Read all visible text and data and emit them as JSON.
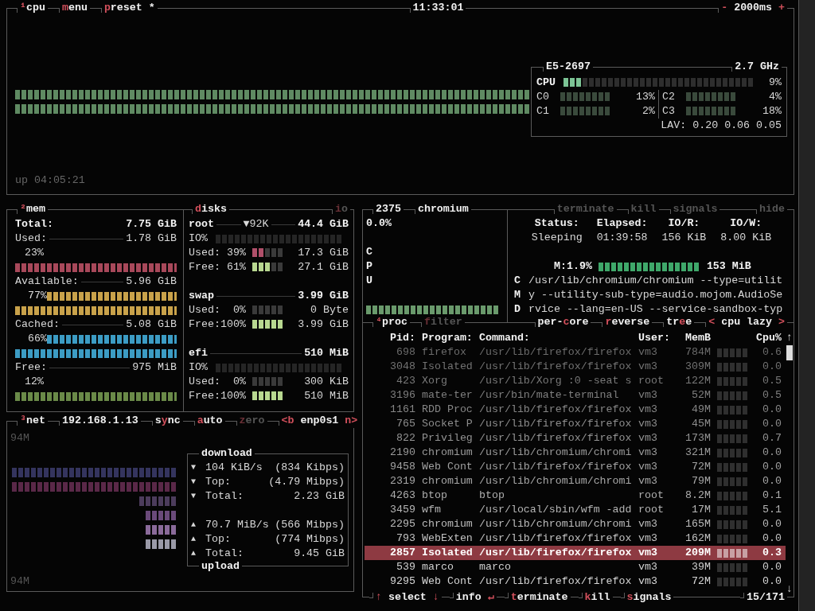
{
  "cpu": {
    "tabs": [
      {
        "hotkey": "¹",
        "label": "cpu",
        "disabled": false
      },
      {
        "hotkey": "m",
        "label": "enu",
        "disabled": false
      },
      {
        "hotkey": "p",
        "label": "reset *",
        "disabled": false
      }
    ],
    "clock": "11:33:01",
    "interval": {
      "hotkey": "-",
      "label": " 2000ms ",
      "hotkey_end": "+",
      "disabled": false
    },
    "info": {
      "model": "E5-2697",
      "frequency": "2.7 GHz",
      "total": {
        "label": "CPU",
        "level": 0.09,
        "value": "9%"
      },
      "cores": [
        {
          "label": "C0",
          "value": "13%"
        },
        {
          "label": "C2",
          "value": "4%"
        },
        {
          "label": "C1",
          "value": "2%"
        },
        {
          "label": "C3",
          "value": "18%"
        }
      ],
      "load_label": "LAV:",
      "load": [
        "0.20",
        "0.06",
        "0.05"
      ]
    },
    "uptime": "up 04:05:21"
  },
  "mem": {
    "tabs": [
      {
        "hotkey": "²",
        "label": "mem",
        "disabled": false
      }
    ],
    "total": {
      "label": "Total:",
      "value": "7.75 GiB"
    },
    "items": [
      {
        "kind": "separate",
        "label": "Used:",
        "value": "1.78 GiB",
        "percent": "23%",
        "color": "#a8485a"
      },
      {
        "kind": "inline",
        "label": "Available:",
        "value": "5.96 GiB",
        "percent": "77%",
        "color": "#c9a24a"
      },
      {
        "kind": "inline",
        "label": "Cached:",
        "value": "5.08 GiB",
        "percent": "66%",
        "color": "#3c9cc4"
      },
      {
        "kind": "separate",
        "label": "Free:",
        "value": "975 MiB",
        "percent": "12%",
        "color": "#6a8a48"
      }
    ]
  },
  "disks": {
    "tabs": [
      {
        "hotkey": "d",
        "label": "isks",
        "disabled": false
      }
    ],
    "tabs_right": [
      {
        "hotkey": "i",
        "label": "o",
        "disabled": true
      }
    ],
    "items": [
      {
        "name": "root",
        "rate": "▼92K",
        "size": "44.4 GiB",
        "rows": [
          {
            "kind": "io",
            "label": "IO%"
          },
          {
            "kind": "used",
            "label": "Used:",
            "percent": "39%",
            "level": 0.39,
            "value": "17.3 GiB"
          },
          {
            "kind": "free",
            "label": "Free:",
            "percent": "61%",
            "level": 0.61,
            "value": "27.1 GiB"
          }
        ]
      },
      {
        "name": "swap",
        "size": "3.99 GiB",
        "rows": [
          {
            "kind": "used",
            "label": "Used:",
            "percent": "0%",
            "level": 0,
            "value": "0 Byte"
          },
          {
            "kind": "free",
            "label": "Free:",
            "percent": "100%",
            "level": 1,
            "value": "3.99 GiB"
          }
        ]
      },
      {
        "name": "efi",
        "size": "510 MiB",
        "rows": [
          {
            "kind": "io",
            "label": "IO%"
          },
          {
            "kind": "used",
            "label": "Used:",
            "percent": "0%",
            "level": 0,
            "value": "300 KiB"
          },
          {
            "kind": "free",
            "label": "Free:",
            "percent": "100%",
            "level": 1,
            "value": "510 MiB"
          }
        ]
      }
    ]
  },
  "net": {
    "tabs": [
      {
        "hotkey": "³",
        "label": "net",
        "disabled": false
      },
      {
        "label": "192.168.1.13",
        "disabled": false
      },
      {
        "prefix": "s",
        "hotkey": "y",
        "label": "nc",
        "disabled": false
      },
      {
        "hotkey": "a",
        "label": "uto",
        "disabled": false
      },
      {
        "hotkey": "z",
        "label": "ero",
        "disabled": true
      },
      {
        "hotkey": "<b",
        "label": " enp0s1 ",
        "hotkey_end": "n>",
        "disabled": false
      }
    ],
    "scale_top": "94M",
    "scale_bottom": "94M",
    "download": {
      "title": "download",
      "rows": [
        {
          "arrow": "▼",
          "label": "104 KiB/s",
          "value": "(834 Kibps)"
        },
        {
          "arrow": "▼",
          "label": "Top:",
          "value": "(4.79 Mibps)"
        },
        {
          "arrow": "▼",
          "label": "Total:",
          "value": "2.23 GiB"
        }
      ]
    },
    "upload": {
      "title": "upload",
      "rows": [
        {
          "arrow": "▲",
          "label": "70.7 MiB/s",
          "value": "(566 Mibps)"
        },
        {
          "arrow": "▲",
          "label": "Top:",
          "value": "(774 Mibps)"
        },
        {
          "arrow": "▲",
          "label": "Total:",
          "value": "9.45 GiB"
        }
      ]
    }
  },
  "detail": {
    "pid": "2375",
    "name": "chromium",
    "tabs": [
      {
        "label": "terminate",
        "disabled": true
      },
      {
        "label": "kill",
        "disabled": true
      },
      {
        "label": "signals",
        "disabled": true
      }
    ],
    "tabs_right": [
      {
        "label": "hide",
        "disabled": true
      }
    ],
    "cpu": "0.0%",
    "cpu_label": "CPU",
    "stats": [
      {
        "label": "Status:",
        "value": "Sleeping"
      },
      {
        "label": "Elapsed:",
        "value": "01:39:58"
      },
      {
        "label": "IO/R:",
        "value": "156 KiB"
      },
      {
        "label": "IO/W:",
        "value": "8.00 KiB"
      }
    ],
    "memory": {
      "label": "M:1.9%",
      "value": "153 MiB"
    },
    "cmd_label": "CMD",
    "command_lines": [
      "/usr/lib/chromium/chromium --type=utilit",
      "y --utility-sub-type=audio.mojom.AudioSe",
      "rvice --lang=en-US --service-sandbox-typ"
    ]
  },
  "proc": {
    "tabs": [
      {
        "hotkey": "⁴",
        "label": "proc",
        "disabled": false
      },
      {
        "hotkey": "f",
        "label": "ilter",
        "disabled": true
      }
    ],
    "tabs_right": [
      {
        "prefix": "per-",
        "hotkey": "c",
        "label": "ore",
        "disabled": false
      },
      {
        "hotkey": "r",
        "label": "everse",
        "disabled": false
      },
      {
        "prefix": "tr",
        "hotkey": "e",
        "label": "e",
        "disabled": false
      },
      {
        "hotkey": "<",
        "label": " cpu lazy ",
        "hotkey_end": ">",
        "disabled": false
      }
    ],
    "columns": [
      "Pid:",
      "Program:",
      "Command:",
      "User:",
      "MemB",
      "Cpu%"
    ],
    "scroll_up": "↑",
    "scroll_down": "↓",
    "rows": [
      {
        "pid": "698",
        "program": "firefox",
        "command": "/usr/lib/firefox/firefox",
        "user": "vm3",
        "memory": "784M",
        "cpu": "0.6",
        "selected": false
      },
      {
        "pid": "3048",
        "program": "Isolated",
        "command": "/usr/lib/firefox/firefox",
        "user": "vm3",
        "memory": "309M",
        "cpu": "0.0",
        "selected": false
      },
      {
        "pid": "423",
        "program": "Xorg",
        "command": "/usr/lib/Xorg :0 -seat s",
        "user": "root",
        "memory": "122M",
        "cpu": "0.5",
        "selected": false
      },
      {
        "pid": "3196",
        "program": "mate-ter",
        "command": "/usr/bin/mate-terminal",
        "user": "vm3",
        "memory": "52M",
        "cpu": "0.5",
        "selected": false
      },
      {
        "pid": "1161",
        "program": "RDD Proc",
        "command": "/usr/lib/firefox/firefox",
        "user": "vm3",
        "memory": "49M",
        "cpu": "0.0",
        "selected": false
      },
      {
        "pid": "765",
        "program": "Socket P",
        "command": "/usr/lib/firefox/firefox",
        "user": "vm3",
        "memory": "45M",
        "cpu": "0.0",
        "selected": false
      },
      {
        "pid": "822",
        "program": "Privileg",
        "command": "/usr/lib/firefox/firefox",
        "user": "vm3",
        "memory": "173M",
        "cpu": "0.7",
        "selected": false
      },
      {
        "pid": "2190",
        "program": "chromium",
        "command": "/usr/lib/chromium/chromi",
        "user": "vm3",
        "memory": "321M",
        "cpu": "0.0",
        "selected": false
      },
      {
        "pid": "9458",
        "program": "Web Cont",
        "command": "/usr/lib/firefox/firefox",
        "user": "vm3",
        "memory": "72M",
        "cpu": "0.0",
        "selected": false
      },
      {
        "pid": "2319",
        "program": "chromium",
        "command": "/usr/lib/chromium/chromi",
        "user": "vm3",
        "memory": "79M",
        "cpu": "0.0",
        "selected": false
      },
      {
        "pid": "4263",
        "program": "btop",
        "command": "btop",
        "user": "root",
        "memory": "8.2M",
        "cpu": "0.1",
        "selected": false
      },
      {
        "pid": "3459",
        "program": "wfm",
        "command": "/usr/local/sbin/wfm -add",
        "user": "root",
        "memory": "17M",
        "cpu": "5.1",
        "selected": false
      },
      {
        "pid": "2295",
        "program": "chromium",
        "command": "/usr/lib/chromium/chromi",
        "user": "vm3",
        "memory": "165M",
        "cpu": "0.0",
        "selected": false
      },
      {
        "pid": "793",
        "program": "WebExten",
        "command": "/usr/lib/firefox/firefox",
        "user": "vm3",
        "memory": "162M",
        "cpu": "0.0",
        "selected": false
      },
      {
        "pid": "2857",
        "program": "Isolated",
        "command": "/usr/lib/firefox/firefox",
        "user": "vm3",
        "memory": "209M",
        "cpu": "0.3",
        "selected": true
      },
      {
        "pid": "539",
        "program": "marco",
        "command": "marco",
        "user": "vm3",
        "memory": "39M",
        "cpu": "0.0",
        "selected": false
      },
      {
        "pid": "9295",
        "program": "Web Cont",
        "command": "/usr/lib/firefox/firefox",
        "user": "vm3",
        "memory": "72M",
        "cpu": "0.0",
        "selected": false
      }
    ],
    "bottom_tabs": [
      {
        "hotkey": "↑",
        "label": " select ",
        "hotkey_end": "↓",
        "disabled": false
      },
      {
        "label": "info ",
        "hotkey_end": "↵",
        "disabled": false
      },
      {
        "hotkey": "t",
        "label": "erminate",
        "disabled": false
      },
      {
        "hotkey": "k",
        "label": "ill",
        "disabled": false
      },
      {
        "hotkey": "s",
        "label": "ignals",
        "disabled": false
      }
    ],
    "position": "15/171"
  }
}
